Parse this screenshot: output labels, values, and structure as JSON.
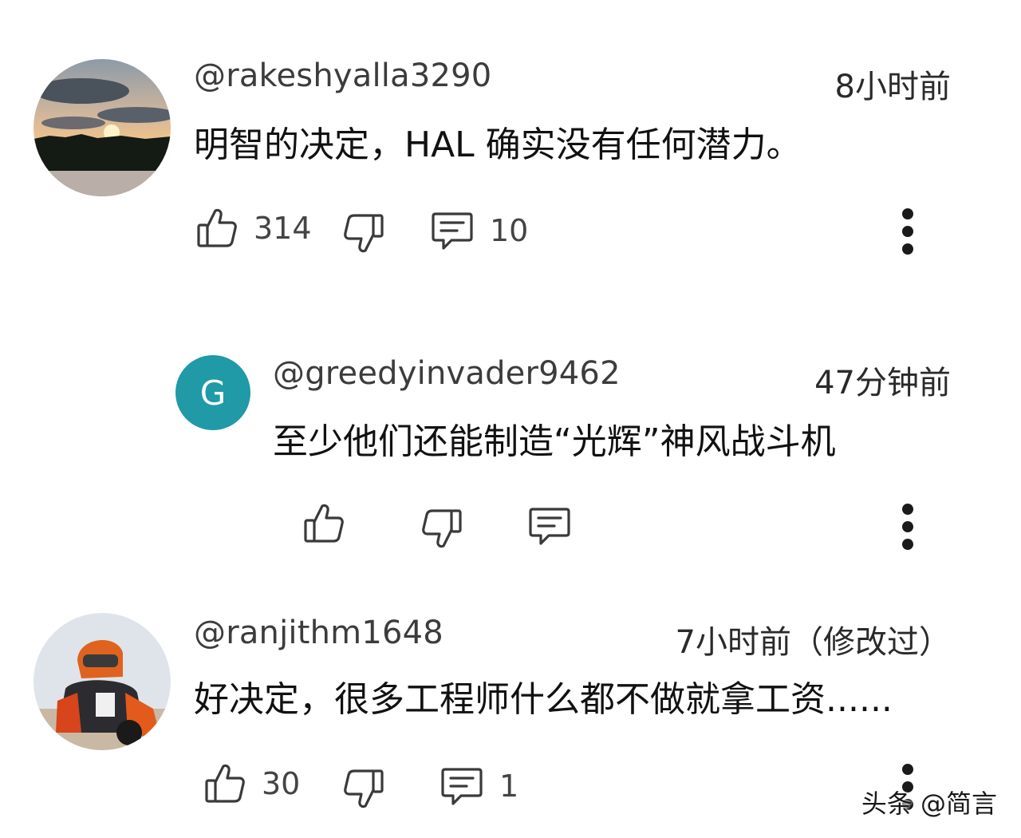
{
  "comments": [
    {
      "username": "@rakeshyalla3290",
      "time": "8小时前",
      "text": "明智的决定，HAL 确实没有任何潜力。",
      "likes": "314",
      "replies": "10"
    },
    {
      "avatar_letter": "G",
      "username": "@greedyinvader9462",
      "time": "47分钟前",
      "text": "至少他们还能制造“光辉”神风战斗机"
    },
    {
      "username": "@ranjithm1648",
      "time": "7小时前（修改过）",
      "text": "好决定，很多工程师什么都不做就拿工资......",
      "likes": "30",
      "replies": "1"
    }
  ],
  "watermark": "头条 @简言",
  "colors": {
    "accent_avatar": "#1f9aa6",
    "icon_stroke": "#3a3a3a"
  }
}
